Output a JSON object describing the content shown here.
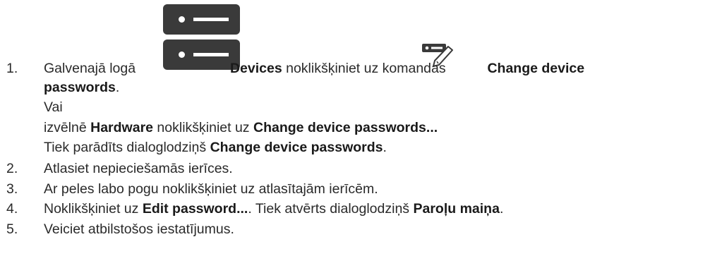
{
  "steps": [
    {
      "number": "1.",
      "line1": {
        "pre": "Galvenajā logā",
        "bold1": "Devices",
        "mid": "noklikšķiniet uz komandas",
        "bold2": "Change device"
      },
      "line2_bold": "passwords",
      "line2_after": ".",
      "or": "Vai",
      "menu": {
        "pre": "izvēlnē",
        "bold1": "Hardware",
        "mid": "noklikšķiniet uz",
        "bold2": "Change device passwords..."
      },
      "result": {
        "pre": "Tiek parādīts dialoglodziņš",
        "bold": "Change device passwords",
        "after": "."
      }
    },
    {
      "number": "2.",
      "text": "Atlasiet nepieciešamās ierīces."
    },
    {
      "number": "3.",
      "text": "Ar peles labo pogu noklikšķiniet uz atlasītajām ierīcēm."
    },
    {
      "number": "4.",
      "pre": "Noklikšķiniet uz",
      "bold1": "Edit password...",
      "mid": ". Tiek atvērts dialoglodziņš",
      "bold2": "Paroļu maiņa",
      "after": "."
    },
    {
      "number": "5.",
      "text": "Veiciet atbilstošos iestatījumus."
    }
  ],
  "icons": {
    "devices": "devices-server-icon",
    "password": "change-password-icon"
  }
}
